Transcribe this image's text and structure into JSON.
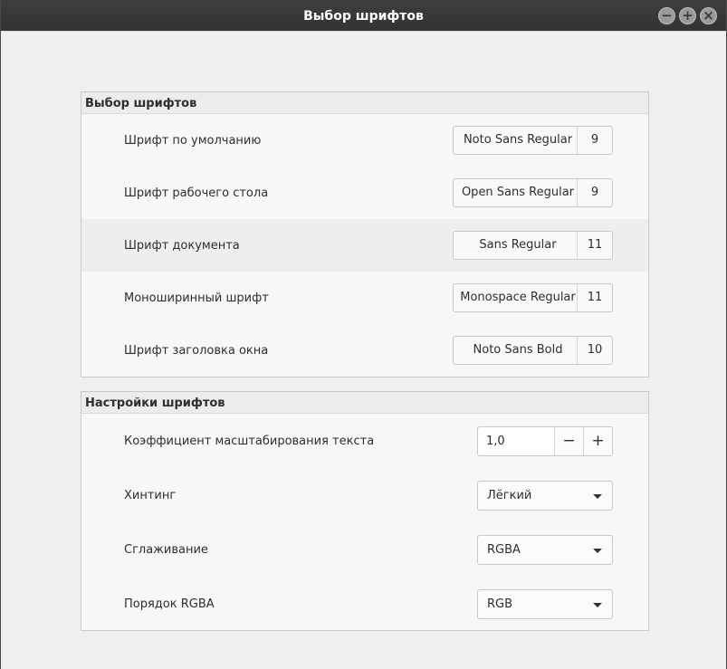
{
  "window": {
    "title": "Выбор шрифтов",
    "buttons": [
      "−",
      "+",
      "×"
    ]
  },
  "font_selection": {
    "header": "Выбор шрифтов",
    "rows": [
      {
        "label": "Шрифт по умолчанию",
        "font": "Noto Sans Regular",
        "size": "9"
      },
      {
        "label": "Шрифт рабочего стола",
        "font": "Open Sans Regular",
        "size": "9"
      },
      {
        "label": "Шрифт документа",
        "font": "Sans Regular",
        "size": "11"
      },
      {
        "label": "Моноширинный шрифт",
        "font": "Monospace Regular",
        "size": "11"
      },
      {
        "label": "Шрифт заголовка окна",
        "font": "Noto Sans Bold",
        "size": "10"
      }
    ]
  },
  "font_settings": {
    "header": "Настройки шрифтов",
    "scale": {
      "label": "Коэффициент масштабирования текста",
      "value": "1,0",
      "minus": "−",
      "plus": "+"
    },
    "hinting": {
      "label": "Хинтинг",
      "value": "Лёгкий"
    },
    "antialiasing": {
      "label": "Сглаживание",
      "value": "RGBA"
    },
    "rgba_order": {
      "label": "Порядок RGBA",
      "value": "RGB"
    }
  }
}
